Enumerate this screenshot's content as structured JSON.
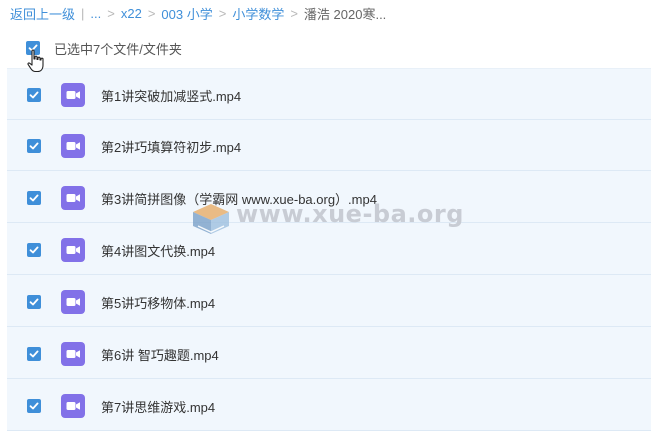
{
  "breadcrumb": {
    "back": "返回上一级",
    "ellipsis": "...",
    "items": [
      "x22",
      "003 小学",
      "小学数学"
    ],
    "current": "潘浩 2020寒..."
  },
  "selection": {
    "label": "已选中7个文件/文件夹"
  },
  "files": [
    {
      "name": "第1讲突破加减竖式.mp4"
    },
    {
      "name": "第2讲巧填算符初步.mp4"
    },
    {
      "name": "第3讲简拼图像（学霸网 www.xue-ba.org）.mp4"
    },
    {
      "name": "第4讲图文代换.mp4"
    },
    {
      "name": "第5讲巧移物体.mp4"
    },
    {
      "name": "第6讲 智巧趣题.mp4"
    },
    {
      "name": "第7讲思维游戏.mp4"
    }
  ],
  "watermark": {
    "text": "www.xue-ba.org"
  },
  "colors": {
    "accent": "#3f8fd9",
    "video_icon": "#8271e8",
    "row_bg": "#f1f7fd"
  },
  "icons": {
    "checkbox": "check-icon",
    "file": "video-file-icon",
    "cursor": "hand-pointer-icon"
  }
}
